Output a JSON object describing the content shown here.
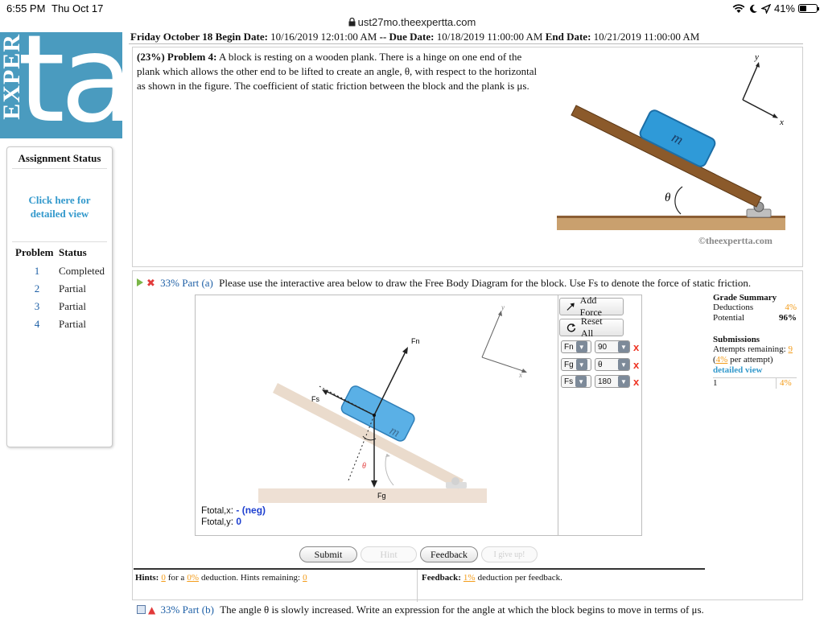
{
  "status_bar": {
    "time": "6:55 PM",
    "date": "Thu Oct 17",
    "battery": "41%",
    "battery_level": 0.41
  },
  "browser": {
    "url": "ust27mo.theexpertta.com"
  },
  "logo": {
    "big": "ta",
    "side": "EXPER"
  },
  "sidebar": {
    "assignment_status_title": "Assignment Status",
    "detail_link": "Click here for detailed view",
    "problem_header": "Problem",
    "status_header": "Status",
    "problems": [
      {
        "num": "1",
        "status": "Completed"
      },
      {
        "num": "2",
        "status": "Partial"
      },
      {
        "num": "3",
        "status": "Partial"
      },
      {
        "num": "4",
        "status": "Partial"
      }
    ]
  },
  "header": {
    "day": "Friday October 18",
    "begin_label": "Begin Date:",
    "begin": "10/16/2019 12:01:00 AM",
    "sep": "--",
    "due_label": "Due Date:",
    "due": "10/18/2019 11:00:00 AM",
    "end_label": "End Date:",
    "end": "10/21/2019 11:00:00 AM"
  },
  "problem": {
    "weight": "(23%)",
    "title": "Problem 4:",
    "text": "A block is resting on a wooden plank. There is a hinge on one end of the plank which allows the other end to be lifted to create an angle, θ, with respect to the horizontal as shown in the figure. The coefficient of static friction between the block and the plank is μs."
  },
  "figure": {
    "mass_label": "m",
    "angle_label": "θ",
    "axis_x": "x",
    "axis_y": "y",
    "copyright": "©theexpertta.com"
  },
  "part_a": {
    "weight": "33%",
    "title": "Part (a)",
    "text": "Please use the interactive area below to draw the Free Body Diagram for the block. Use Fs to denote the force of static friction.",
    "add_force": "Add Force",
    "reset_all": "Reset All",
    "forces": [
      {
        "name": "Fn",
        "angle": "90"
      },
      {
        "name": "Fg",
        "angle": "θ"
      },
      {
        "name": "Fs",
        "angle": "180"
      }
    ],
    "fbd_labels": {
      "fn": "Fn",
      "fs": "Fs",
      "fg": "Fg",
      "m": "m",
      "theta": "θ",
      "x": "x",
      "y": "y"
    },
    "ftotal_x_label": "F",
    "ftotal_x_sub": "total,x",
    "ftotal_x_value": "- (neg)",
    "ftotal_y_label": "F",
    "ftotal_y_sub": "total,y",
    "ftotal_y_value": "0"
  },
  "grade_summary": {
    "title": "Grade Summary",
    "deductions_label": "Deductions",
    "deductions": "4%",
    "potential_label": "Potential",
    "potential": "96%",
    "submissions_title": "Submissions",
    "attempts_label": "Attempts remaining:",
    "attempts": "9",
    "per_attempt_pct": "4%",
    "per_attempt_label": "per attempt)",
    "detail_link": "detailed view",
    "sub_num": "1",
    "sub_pct": "4%"
  },
  "actions": {
    "submit": "Submit",
    "hint": "Hint",
    "feedback": "Feedback",
    "give_up": "I give up!"
  },
  "hints": {
    "label": "Hints:",
    "count": "0",
    "for_a": "for a",
    "pct": "0%",
    "rest": "deduction. Hints remaining:",
    "remaining": "0"
  },
  "feedback": {
    "label": "Feedback:",
    "pct": "1%",
    "rest": "deduction per feedback."
  },
  "part_b": {
    "weight": "33%",
    "title": "Part (b)",
    "text": "The angle θ is slowly increased. Write an expression for the angle at which the block begins to move in terms of μs."
  }
}
